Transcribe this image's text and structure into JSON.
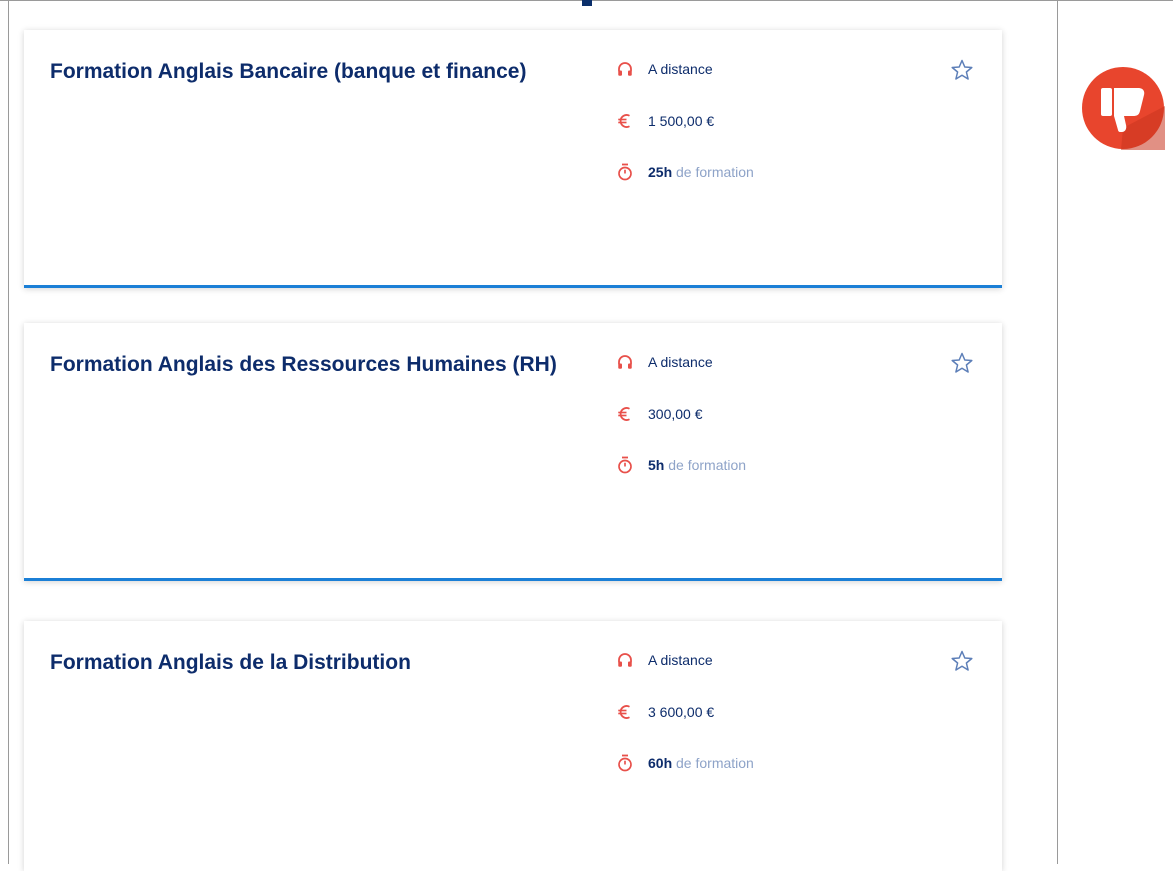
{
  "courses": [
    {
      "title": "Formation Anglais Bancaire (banque et finance)",
      "mode": "A distance",
      "price": "1 500,00 €",
      "hours": "25h",
      "hours_suffix": "de formation",
      "favorite_icon": "star-outline-icon"
    },
    {
      "title": "Formation Anglais des Ressources Humaines (RH)",
      "mode": "A distance",
      "price": "300,00 €",
      "hours": "5h",
      "hours_suffix": "de formation",
      "favorite_icon": "star-outline-icon"
    },
    {
      "title": "Formation Anglais de la Distribution",
      "mode": "A distance",
      "price": "3 600,00 €",
      "hours": "60h",
      "hours_suffix": "de formation",
      "favorite_icon": "star-outline-icon"
    }
  ],
  "icons": {
    "mode": "headphones-icon",
    "price": "euro-icon",
    "hours": "stopwatch-icon",
    "verdict": "thumbs-down-icon"
  },
  "colors": {
    "title": "#0d2c6b",
    "accent_icon": "#e8504a",
    "muted_text": "#8ea3c8",
    "card_border": "#1b7fd6",
    "thumb_bg": "#e8452d"
  }
}
